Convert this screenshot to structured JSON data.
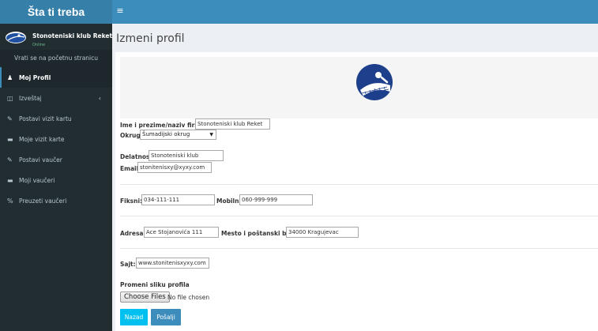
{
  "app": {
    "logo_text": "Šta ti treba",
    "toggle_icon": "hamburger-icon"
  },
  "sidebar": {
    "user_name": "Stonoteniski klub Reket",
    "user_status": "Online",
    "back_link": "Vrati se na početnu stranicu",
    "items": [
      {
        "label": "Moj Profil",
        "icon": "user-icon"
      },
      {
        "label": "Izveštaj",
        "icon": "report-icon"
      },
      {
        "label": "Postavi vizit kartu",
        "icon": "edit-icon"
      },
      {
        "label": "Moje vizit karte",
        "icon": "folder-icon"
      },
      {
        "label": "Postavi vaučer",
        "icon": "edit-icon"
      },
      {
        "label": "Moji vaučeri",
        "icon": "folder-icon"
      },
      {
        "label": "Preuzeti vaučeri",
        "icon": "percent-icon"
      }
    ]
  },
  "page": {
    "title": "Izmeni profil"
  },
  "form": {
    "name_label": "Ime i prezime/naziv firme",
    "name_value": "Stonoteniski klub Reket",
    "okrug_label": "Okrug",
    "okrug_value": "Šumadijski okrug",
    "delatnost_label": "Delatnost",
    "delatnost_value": "Stonoteniski klub",
    "email_label": "Email",
    "email_value": "stonitenisxy@xyxy.com",
    "fiksni_label": "Fiksni:",
    "fiksni_value": "034-111-111",
    "mobilni_label": "Mobilni",
    "mobilni_value": "060-999-999",
    "adresa_label": "Adresa:",
    "adresa_value": "Ace Stojanovića 111",
    "mesto_label": "Mesto i poštanski broj:",
    "mesto_value": "34000 Kragujevac",
    "sajt_label": "Sajt:",
    "sajt_value": "www.stonitenisxyxy.com",
    "photo_label": "Promeni sliku profila",
    "file_button": "Choose Files",
    "file_status": "No file chosen",
    "back_button": "Nazad",
    "send_button": "Pošalji"
  },
  "colors": {
    "header": "#3c8dbc",
    "logo_bg": "#367fa9",
    "sidebar": "#222d32",
    "info": "#00c0ef"
  }
}
